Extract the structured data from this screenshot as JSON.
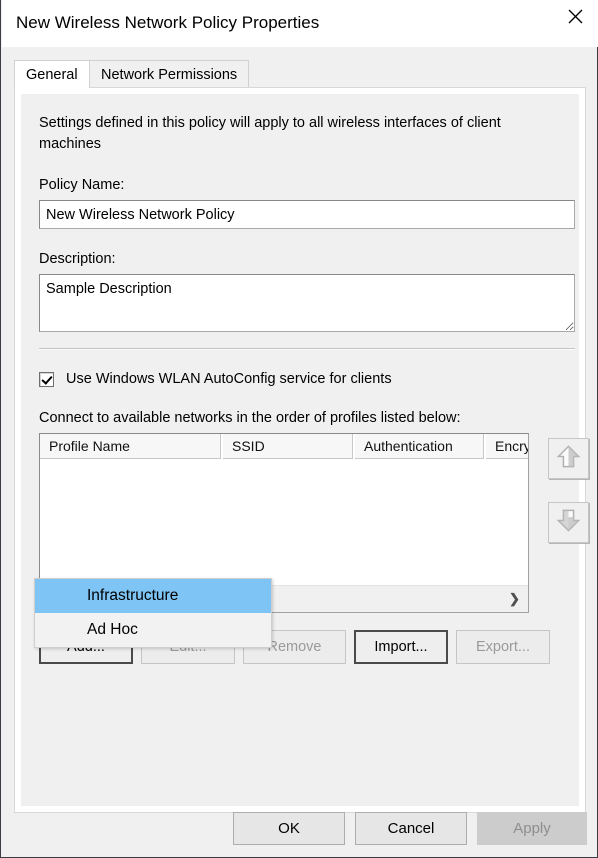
{
  "window": {
    "title": "New Wireless Network Policy Properties",
    "close_icon": "close-icon"
  },
  "tabs": [
    {
      "label": "General",
      "active": true
    },
    {
      "label": "Network Permissions",
      "active": false
    }
  ],
  "general": {
    "intro_text": "Settings defined in this policy will apply to all wireless interfaces of client machines",
    "policy_name_label": "Policy Name:",
    "policy_name_value": "New Wireless Network Policy",
    "policy_name_placeholder": "",
    "description_label": "Description:",
    "description_value": "Sample Description",
    "description_placeholder": "",
    "autoconfig_checkbox_label": "Use Windows WLAN AutoConfig service for clients",
    "autoconfig_checked": true,
    "connect_order_label": "Connect to available networks in the order of profiles listed below:"
  },
  "profile_list": {
    "columns": [
      "Profile Name",
      "SSID",
      "Authentication",
      "Encry"
    ],
    "rows": [],
    "scroll_right_arrow": "chevron-right-icon",
    "move_up_icon": "arrow-up-icon",
    "move_down_icon": "arrow-down-icon",
    "move_up_enabled": false,
    "move_down_enabled": false
  },
  "action_buttons": [
    {
      "label": "Add...",
      "enabled": true,
      "default": true
    },
    {
      "label": "Edit...",
      "enabled": false,
      "default": false
    },
    {
      "label": "Remove",
      "enabled": false,
      "default": false
    },
    {
      "label": "Import...",
      "enabled": true,
      "default": true
    },
    {
      "label": "Export...",
      "enabled": false,
      "default": false
    }
  ],
  "dropdown": {
    "visible": true,
    "items": [
      {
        "label": "Infrastructure",
        "selected": true
      },
      {
        "label": "Ad Hoc",
        "selected": false
      }
    ]
  },
  "footer_buttons": [
    {
      "label": "OK",
      "enabled": true
    },
    {
      "label": "Cancel",
      "enabled": true
    },
    {
      "label": "Apply",
      "enabled": false
    }
  ],
  "colors": {
    "dialog_bg": "#f0f0f0",
    "titlebar_bg": "#ffffff",
    "accent_highlight": "#7ec4f4",
    "scroll_thumb": "#cdcdcd",
    "disabled_text": "#9a9a9a"
  }
}
